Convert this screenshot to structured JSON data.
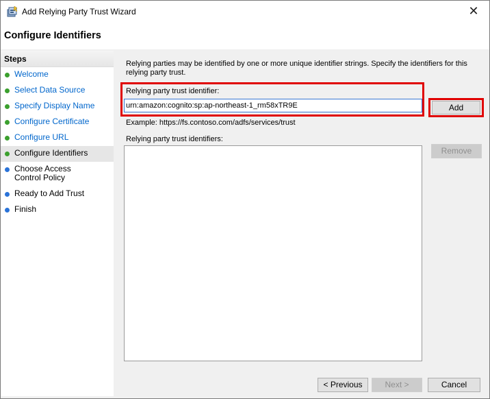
{
  "window": {
    "title": "Add Relying Party Trust Wizard",
    "close_glyph": "✕"
  },
  "page": {
    "title": "Configure Identifiers"
  },
  "steps": {
    "heading": "Steps",
    "items": [
      {
        "label": "Welcome",
        "status": "done"
      },
      {
        "label": "Select Data Source",
        "status": "done"
      },
      {
        "label": "Specify Display Name",
        "status": "done"
      },
      {
        "label": "Configure Certificate",
        "status": "done"
      },
      {
        "label": "Configure URL",
        "status": "done"
      },
      {
        "label": "Configure Identifiers",
        "status": "current"
      },
      {
        "label": "Choose Access Control Policy",
        "status": "todo"
      },
      {
        "label": "Ready to Add Trust",
        "status": "todo"
      },
      {
        "label": "Finish",
        "status": "todo"
      }
    ]
  },
  "content": {
    "intro": "Relying parties may be identified by one or more unique identifier strings. Specify the identifiers for this relying party trust.",
    "identifier_label": "Relying party trust identifier:",
    "identifier_value": "urn:amazon:cognito:sp:ap-northeast-1_rm58xTR9E",
    "add_label": "Add",
    "example": "Example: https://fs.contoso.com/adfs/services/trust",
    "list_label": "Relying party trust identifiers:",
    "list_items": [],
    "remove_label": "Remove"
  },
  "footer": {
    "previous_label": "< Previous",
    "next_label": "Next >",
    "cancel_label": "Cancel"
  },
  "colors": {
    "highlight": "#e00000",
    "step_done": "#3ba02e",
    "step_todo": "#2a73d8",
    "link": "#0066cc"
  },
  "icons": {
    "app": "wizard-app-icon",
    "step_done": "green-dot-icon",
    "step_todo": "blue-dot-icon"
  }
}
